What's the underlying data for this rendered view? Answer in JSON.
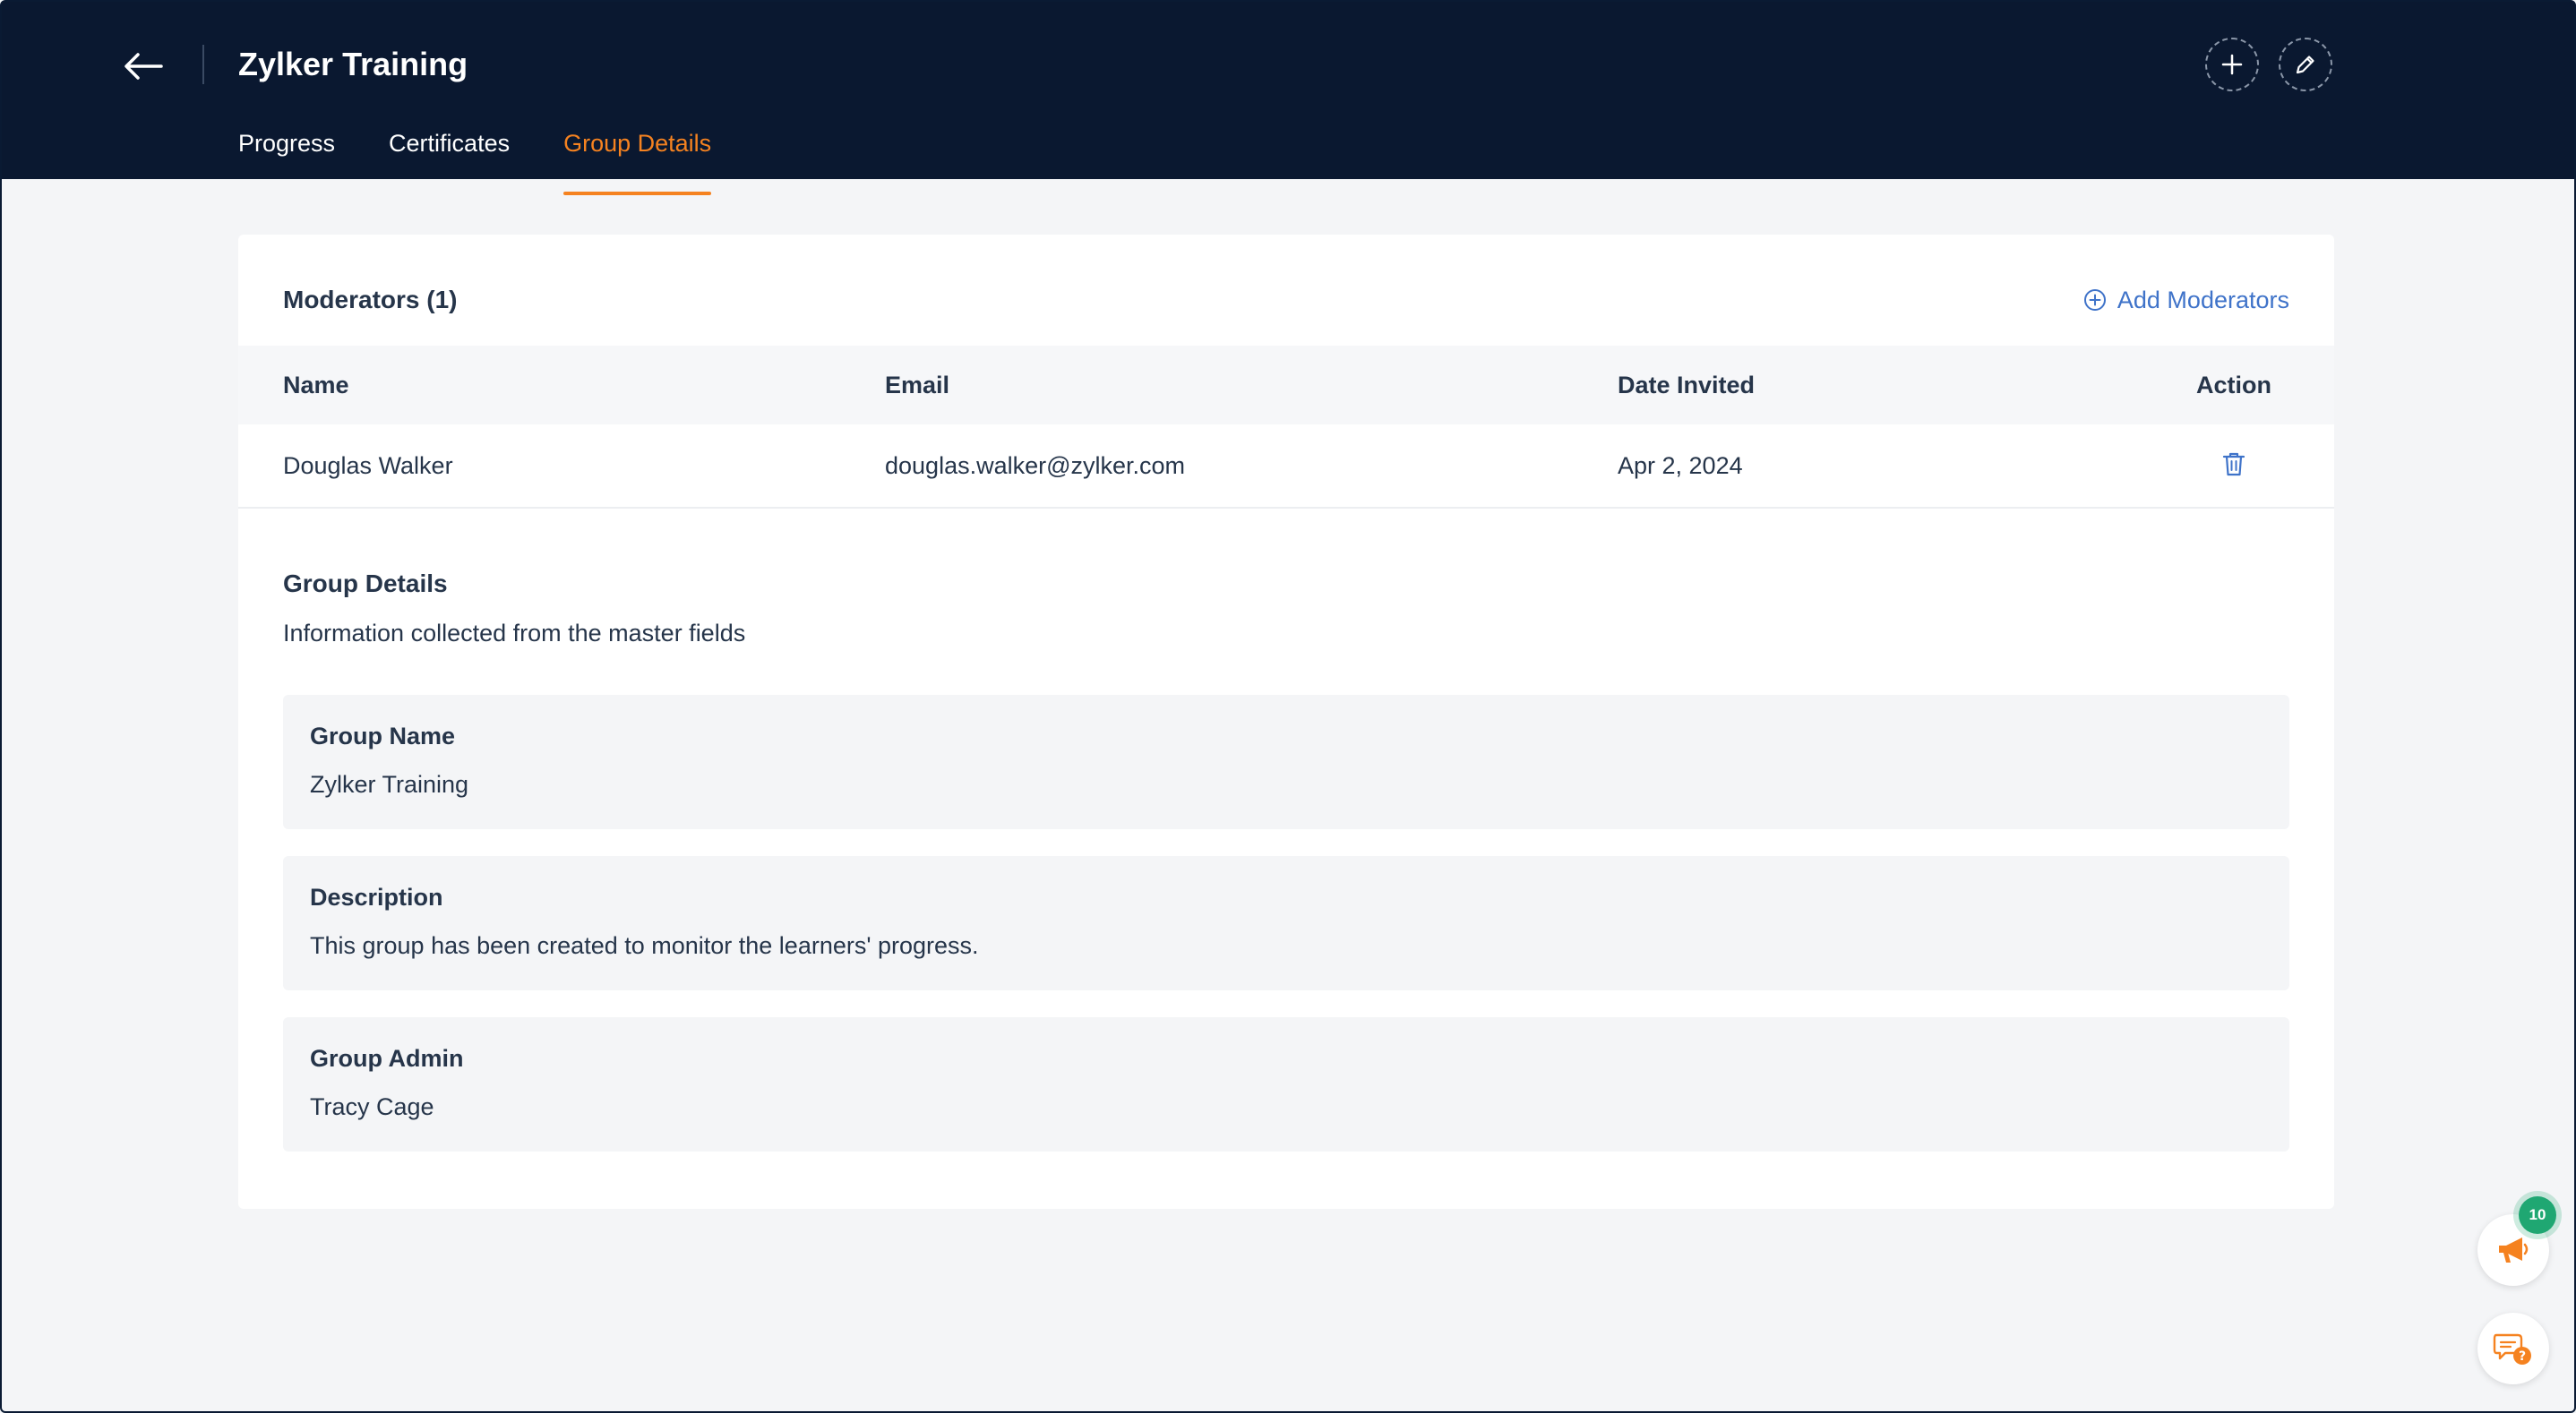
{
  "header": {
    "title": "Zylker Training",
    "tabs": [
      {
        "label": "Progress"
      },
      {
        "label": "Certificates"
      },
      {
        "label": "Group Details"
      }
    ]
  },
  "moderators": {
    "title": "Moderators (1)",
    "add_label": "Add Moderators",
    "columns": {
      "name": "Name",
      "email": "Email",
      "date": "Date Invited",
      "action": "Action"
    },
    "rows": [
      {
        "name": "Douglas Walker",
        "email": "douglas.walker@zylker.com",
        "date": "Apr 2, 2024"
      }
    ]
  },
  "details": {
    "title": "Group Details",
    "subtitle": "Information collected from the master fields",
    "fields": [
      {
        "label": "Group Name",
        "value": "Zylker Training"
      },
      {
        "label": "Description",
        "value": "This group has been created to monitor the learners' progress."
      },
      {
        "label": "Group Admin",
        "value": "Tracy Cage"
      }
    ]
  },
  "notifications": {
    "count": "10"
  },
  "colors": {
    "header_bg": "#0a1830",
    "accent": "#f58220",
    "link": "#3f73c9",
    "badge": "#1fa772"
  }
}
